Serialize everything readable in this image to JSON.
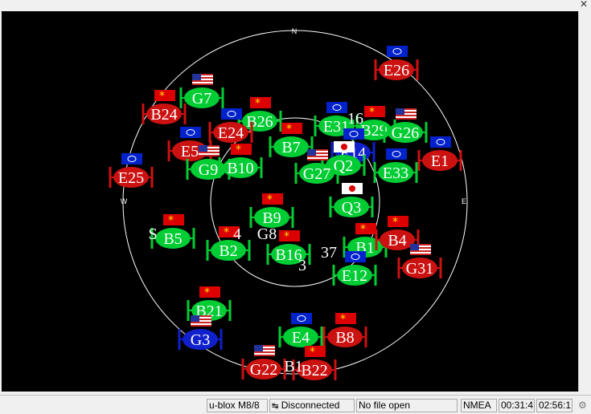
{
  "compass": {
    "north": "N",
    "east": "E",
    "west": "W"
  },
  "colors": {
    "gps": "#00cc33",
    "beidou": "#cc1111",
    "galileo": "#cc1111",
    "qzss": "#00cc33",
    "inactive_blue": "#1020cc"
  },
  "satellites": [
    {
      "id": "E26",
      "flag": "eu",
      "color": "red"
    },
    {
      "id": "G7",
      "flag": "us",
      "color": "green"
    },
    {
      "id": "B24",
      "flag": "cn",
      "color": "red"
    },
    {
      "id": "B26",
      "flag": "cn",
      "color": "green"
    },
    {
      "id": "E24",
      "flag": "eu",
      "color": "red"
    },
    {
      "id": "E31",
      "flag": "eu",
      "color": "green"
    },
    {
      "id": "B29",
      "flag": "cn",
      "color": "green"
    },
    {
      "id": "G26",
      "flag": "us",
      "color": "green"
    },
    {
      "id": "E5",
      "flag": "eu",
      "color": "red"
    },
    {
      "id": "G9",
      "flag": "us",
      "color": "green"
    },
    {
      "id": "B10",
      "flag": "cn",
      "color": "green"
    },
    {
      "id": "B7",
      "flag": "cn",
      "color": "green"
    },
    {
      "id": "E14",
      "flag": "eu",
      "color": "blue"
    },
    {
      "id": "Q2",
      "flag": "jp",
      "color": "green"
    },
    {
      "id": "G27",
      "flag": "us",
      "color": "green"
    },
    {
      "id": "E33",
      "flag": "eu",
      "color": "green"
    },
    {
      "id": "E1",
      "flag": "eu",
      "color": "red"
    },
    {
      "id": "E25",
      "flag": "eu",
      "color": "red"
    },
    {
      "id": "Q3",
      "flag": "jp",
      "color": "green"
    },
    {
      "id": "B9",
      "flag": "cn",
      "color": "green"
    },
    {
      "id": "B5",
      "flag": "cn",
      "color": "green"
    },
    {
      "id": "B2",
      "flag": "cn",
      "color": "green"
    },
    {
      "id": "B16",
      "flag": "cn",
      "color": "green"
    },
    {
      "id": "B1",
      "flag": "cn",
      "color": "green"
    },
    {
      "id": "B4",
      "flag": "cn",
      "color": "red"
    },
    {
      "id": "E12",
      "flag": "eu",
      "color": "green"
    },
    {
      "id": "G31",
      "flag": "us",
      "color": "red"
    },
    {
      "id": "B21",
      "flag": "cn",
      "color": "green"
    },
    {
      "id": "G3",
      "flag": "us",
      "color": "blue"
    },
    {
      "id": "E4",
      "flag": "eu",
      "color": "green"
    },
    {
      "id": "B8",
      "flag": "cn",
      "color": "red"
    },
    {
      "id": "G22",
      "flag": "us",
      "color": "red"
    },
    {
      "id": "B22",
      "flag": "cn",
      "color": "red"
    }
  ],
  "partial_labels": {
    "l1": "16",
    "l2": "S",
    "l3": "4",
    "l4": "G8",
    "l5": "37",
    "l6": "B1",
    "l7": "3"
  },
  "status": {
    "receiver": "u-blox M8/8",
    "connection": "Disconnected",
    "file": "No file open",
    "protocol": "NMEA",
    "time1": "00:31:4",
    "time2": "02:56:1"
  }
}
